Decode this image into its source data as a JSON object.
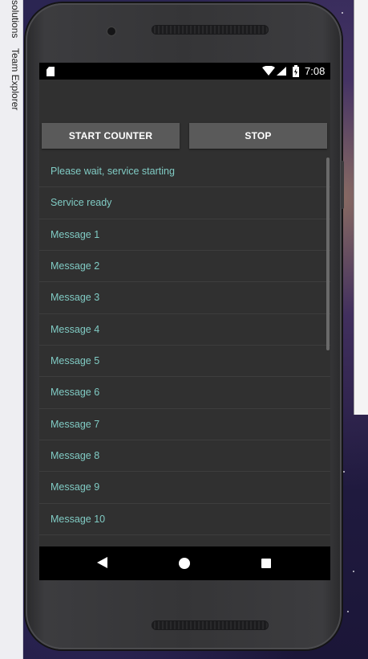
{
  "ide": {
    "tabs": [
      "solutions",
      "Team Explorer"
    ]
  },
  "status_bar": {
    "time": "7:08",
    "icons": [
      "sd-card-icon",
      "wifi-icon",
      "signal-icon",
      "battery-icon"
    ]
  },
  "buttons": {
    "start_label": "START COUNTER",
    "stop_label": "STOP"
  },
  "list": {
    "items": [
      "Please wait, service starting",
      "Service ready",
      "Message 1",
      "Message 2",
      "Message 3",
      "Message 4",
      "Message 5",
      "Message 6",
      "Message 7",
      "Message 8",
      "Message 9",
      "Message 10"
    ]
  },
  "nav": {
    "icons": [
      "back-icon",
      "home-icon",
      "recent-apps-icon"
    ]
  },
  "colors": {
    "list_text": "#80cbc4",
    "button_bg": "#5a5a5a",
    "screen_bg": "#303030"
  }
}
